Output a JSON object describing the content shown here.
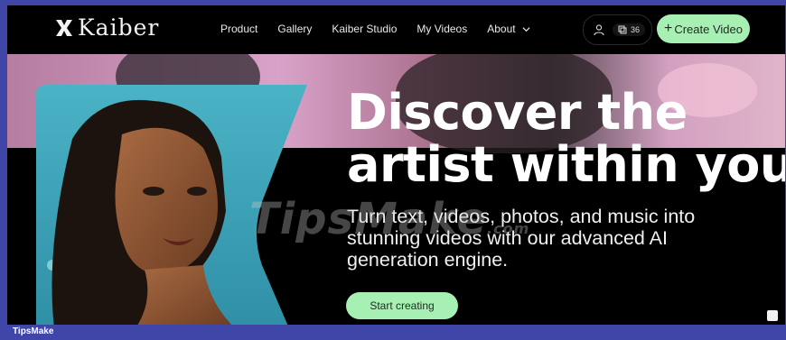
{
  "app": {
    "brand": "Kaiber",
    "logo_icon": "kaiber-k-logo-icon"
  },
  "nav": {
    "items": [
      {
        "label": "Product"
      },
      {
        "label": "Gallery"
      },
      {
        "label": "Kaiber Studio"
      },
      {
        "label": "My Videos"
      },
      {
        "label": "About",
        "has_dropdown": true
      }
    ]
  },
  "account": {
    "user_icon": "user-icon",
    "credits_icon": "credits-icon",
    "credits": "36"
  },
  "actions": {
    "create_video_label": "Create Video",
    "start_creating_label": "Start creating"
  },
  "hero": {
    "headline_line1": "Discover the",
    "headline_line2": "artist within you",
    "subheading": "Turn text, videos, photos, and music into stunning videos with our advanced AI generation engine."
  },
  "watermark": {
    "text": "TipsMake",
    "domain": ".com"
  },
  "footer": {
    "tag": "TipsMake"
  },
  "colors": {
    "accent_green": "#a7f0b4",
    "background": "#000000",
    "outer_frame": "#3f46a8"
  }
}
